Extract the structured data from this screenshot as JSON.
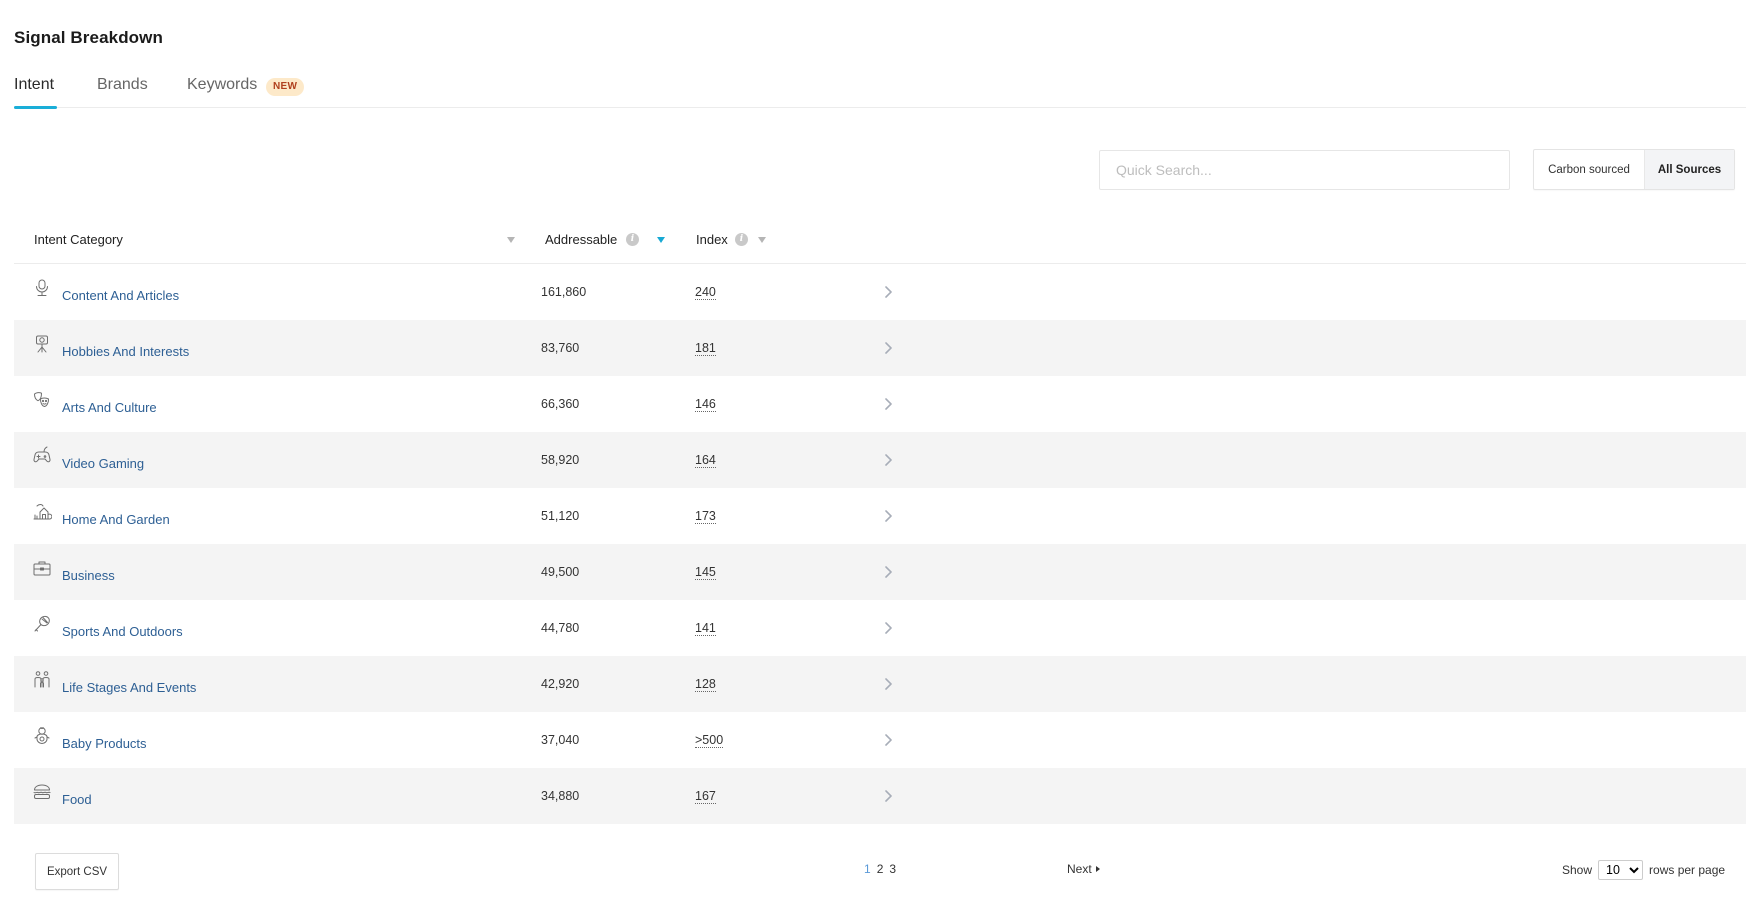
{
  "title": "Signal Breakdown",
  "tabs": [
    {
      "label": "Intent",
      "active": true
    },
    {
      "label": "Brands",
      "active": false
    },
    {
      "label": "Keywords",
      "active": false,
      "badge": "NEW"
    }
  ],
  "search": {
    "placeholder": "Quick Search...",
    "value": ""
  },
  "source_toggle": {
    "options": [
      "Carbon sourced",
      "All Sources"
    ],
    "selected": "All Sources"
  },
  "table": {
    "columns": {
      "category": "Intent Category",
      "addressable": "Addressable",
      "index": "Index"
    },
    "sort": {
      "column": "Addressable",
      "direction": "desc"
    },
    "rows": [
      {
        "icon": "microphone-icon",
        "name": "Content And Articles",
        "addressable": "161,860",
        "index": "240"
      },
      {
        "icon": "camera-tripod-icon",
        "name": "Hobbies And Interests",
        "addressable": "83,760",
        "index": "181"
      },
      {
        "icon": "theater-masks-icon",
        "name": "Arts And Culture",
        "addressable": "66,360",
        "index": "146"
      },
      {
        "icon": "gamepad-icon",
        "name": "Video Gaming",
        "addressable": "58,920",
        "index": "164"
      },
      {
        "icon": "house-garden-icon",
        "name": "Home And Garden",
        "addressable": "51,120",
        "index": "173"
      },
      {
        "icon": "briefcase-icon",
        "name": "Business",
        "addressable": "49,500",
        "index": "145"
      },
      {
        "icon": "racket-icon",
        "name": "Sports And Outdoors",
        "addressable": "44,780",
        "index": "141"
      },
      {
        "icon": "family-icon",
        "name": "Life Stages And Events",
        "addressable": "42,920",
        "index": "128"
      },
      {
        "icon": "baby-icon",
        "name": "Baby Products",
        "addressable": "37,040",
        "index": ">500"
      },
      {
        "icon": "burger-icon",
        "name": "Food",
        "addressable": "34,880",
        "index": "167"
      }
    ]
  },
  "footer": {
    "export_label": "Export CSV",
    "pages": [
      "1",
      "2",
      "3"
    ],
    "current_page": "1",
    "next_label": "Next",
    "show_label": "Show",
    "rows_per_page_value": "10",
    "rows_per_page_suffix": "rows per page"
  },
  "colors": {
    "accent": "#1aaed8",
    "link": "#2d5f94",
    "badge_bg": "#fde9c9",
    "badge_text": "#b0401e",
    "row_alt": "#f4f4f4"
  }
}
